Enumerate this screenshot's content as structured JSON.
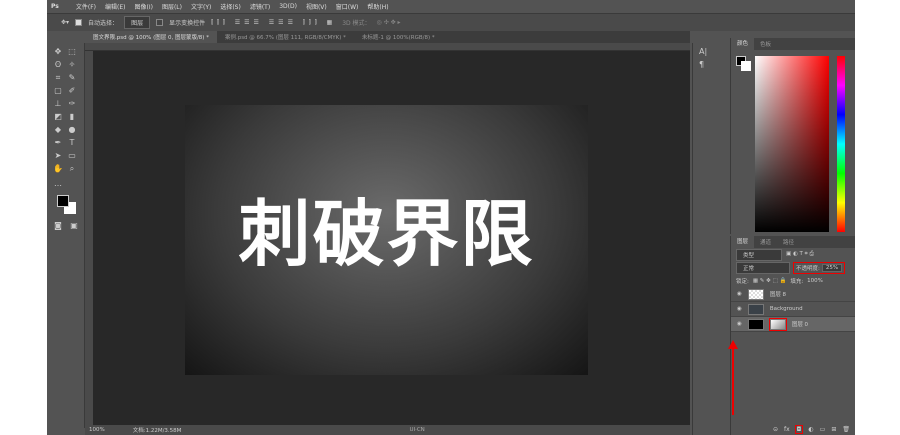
{
  "app": {
    "logo": "Ps"
  },
  "menu": [
    "文件(F)",
    "编辑(E)",
    "图像(I)",
    "图层(L)",
    "文字(Y)",
    "选择(S)",
    "滤镜(T)",
    "3D(D)",
    "视图(V)",
    "窗口(W)",
    "帮助(H)"
  ],
  "options": {
    "auto_select_label": "自动选择：",
    "auto_select_value": "图层",
    "show_transform": "显示变换控件",
    "mode_3d": "3D 模式："
  },
  "tabs": [
    "图文界限.psd @ 100% (图层 0, 图层蒙版/8) *",
    "案例.psd @ 66.7% (图层 111, RGB/8/CMYK) *",
    "未标题-1 @ 100%(RGB/8) *"
  ],
  "canvas": {
    "artwork_text": "刺破界限"
  },
  "status": {
    "zoom": "100%",
    "doc": "文档:1.22M/3.58M"
  },
  "color_panel": {
    "tabs": [
      "颜色",
      "色板"
    ]
  },
  "layers_panel": {
    "tabs": [
      "图层",
      "通道",
      "路径"
    ],
    "filter": "类型",
    "blend_mode": "正常",
    "opacity_label": "不透明度:",
    "opacity": "25%",
    "lock_label": "锁定:",
    "fill_label": "填充:",
    "fill": "100%",
    "layers": [
      {
        "name": "图层 8"
      },
      {
        "name": "Background"
      },
      {
        "name": "图层 0"
      }
    ]
  },
  "watermark": "UI·CN",
  "colors": {
    "accent": "#e00000"
  }
}
